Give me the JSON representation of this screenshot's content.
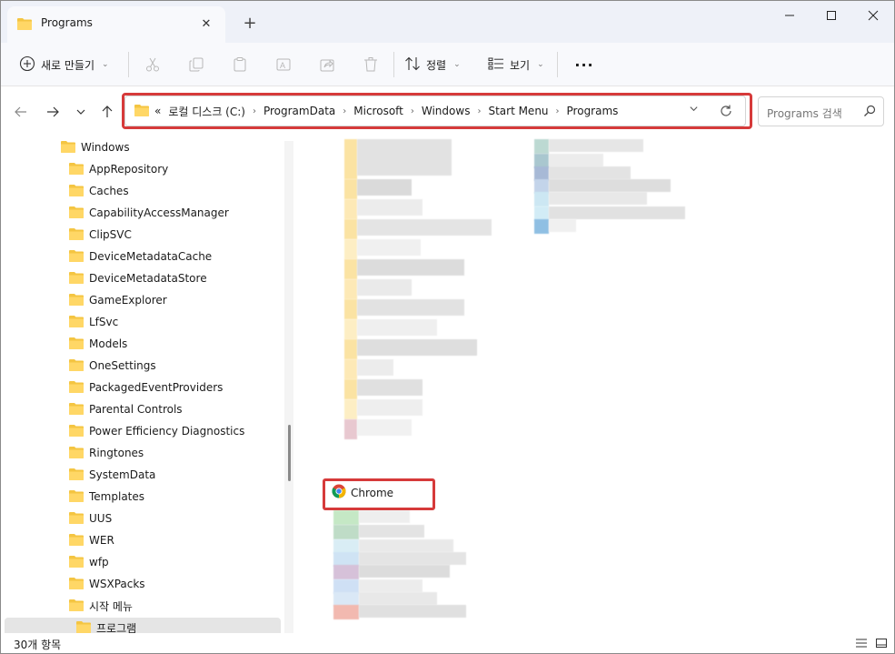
{
  "window": {
    "tab_title": "Programs",
    "new_tab_symbol": "+",
    "close_tab_symbol": "✕"
  },
  "toolbar": {
    "new_label": "새로 만들기",
    "sort_label": "정렬",
    "view_label": "보기",
    "more_label": "···"
  },
  "address": {
    "overflow": "«",
    "crumbs": [
      "로컬 디스크 (C:)",
      "ProgramData",
      "Microsoft",
      "Windows",
      "Start Menu",
      "Programs"
    ]
  },
  "search": {
    "placeholder": "Programs 검색"
  },
  "sidebar": {
    "items": [
      {
        "label": "Windows",
        "level": 0
      },
      {
        "label": "AppRepository",
        "level": 1
      },
      {
        "label": "Caches",
        "level": 1
      },
      {
        "label": "CapabilityAccessManager",
        "level": 1
      },
      {
        "label": "ClipSVC",
        "level": 1
      },
      {
        "label": "DeviceMetadataCache",
        "level": 1
      },
      {
        "label": "DeviceMetadataStore",
        "level": 1
      },
      {
        "label": "GameExplorer",
        "level": 1
      },
      {
        "label": "LfSvc",
        "level": 1
      },
      {
        "label": "Models",
        "level": 1
      },
      {
        "label": "OneSettings",
        "level": 1
      },
      {
        "label": "PackagedEventProviders",
        "level": 1
      },
      {
        "label": "Parental Controls",
        "level": 1
      },
      {
        "label": "Power Efficiency Diagnostics",
        "level": 1
      },
      {
        "label": "Ringtones",
        "level": 1
      },
      {
        "label": "SystemData",
        "level": 1
      },
      {
        "label": "Templates",
        "level": 1
      },
      {
        "label": "UUS",
        "level": 1
      },
      {
        "label": "WER",
        "level": 1
      },
      {
        "label": "wfp",
        "level": 1
      },
      {
        "label": "WSXPacks",
        "level": 1
      },
      {
        "label": "시작 메뉴",
        "level": 1
      },
      {
        "label": "프로그램",
        "level": 2
      }
    ]
  },
  "content": {
    "highlighted_item": "Chrome"
  },
  "status": {
    "item_count": "30개 항목"
  },
  "colors": {
    "highlight": "#d63a3a",
    "folder": "#f4c542"
  }
}
